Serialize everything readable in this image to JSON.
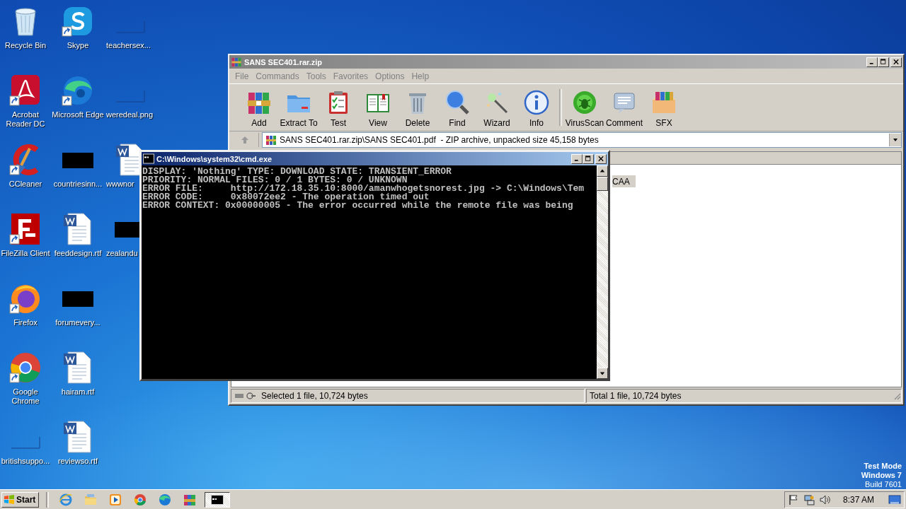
{
  "desktop_icons": [
    {
      "label": "Recycle Bin",
      "kind": "recycle",
      "shortcut": false
    },
    {
      "label": "Acrobat Reader DC",
      "kind": "acrobat",
      "shortcut": true
    },
    {
      "label": "CCleaner",
      "kind": "ccleaner",
      "shortcut": true
    },
    {
      "label": "FileZilla Client",
      "kind": "filezilla",
      "shortcut": true
    },
    {
      "label": "Firefox",
      "kind": "firefox",
      "shortcut": true
    },
    {
      "label": "Google Chrome",
      "kind": "chrome",
      "shortcut": true
    },
    {
      "label": "britishsuppo...",
      "kind": "blank",
      "shortcut": false
    },
    {
      "label": "Skype",
      "kind": "skype",
      "shortcut": true
    },
    {
      "label": "Microsoft Edge",
      "kind": "edge",
      "shortcut": true
    },
    {
      "label": "countriesinn...",
      "kind": "black",
      "shortcut": false
    },
    {
      "label": "feeddesign.rtf",
      "kind": "word",
      "shortcut": false
    },
    {
      "label": "forumevery...",
      "kind": "black",
      "shortcut": false
    },
    {
      "label": "hairam.rtf",
      "kind": "word",
      "shortcut": false
    },
    {
      "label": "reviewso.rtf",
      "kind": "word",
      "shortcut": false
    },
    {
      "label": "teachersex...",
      "kind": "blank",
      "shortcut": false
    },
    {
      "label": "weredeal.png",
      "kind": "blank",
      "shortcut": false
    },
    {
      "label": "wwwnor",
      "kind": "word",
      "shortcut": false
    },
    {
      "label": "zealandu",
      "kind": "black",
      "shortcut": false
    }
  ],
  "winrar": {
    "title": "SANS SEC401.rar.zip",
    "menu": [
      "File",
      "Commands",
      "Tools",
      "Favorites",
      "Options",
      "Help"
    ],
    "toolbar": [
      {
        "label": "Add",
        "kind": "books"
      },
      {
        "label": "Extract To",
        "kind": "folder"
      },
      {
        "label": "Test",
        "kind": "clipboard"
      },
      {
        "label": "View",
        "kind": "book"
      },
      {
        "label": "Delete",
        "kind": "trash"
      },
      {
        "label": "Find",
        "kind": "magnifier"
      },
      {
        "label": "Wizard",
        "kind": "wand"
      },
      {
        "label": "Info",
        "kind": "info"
      },
      {
        "label": "VirusScan",
        "kind": "bug"
      },
      {
        "label": "Comment",
        "kind": "note"
      },
      {
        "label": "SFX",
        "kind": "box"
      }
    ],
    "path": "SANS SEC401.rar.zip\\SANS SEC401.pdf  - ZIP archive, unpacked size 45,158 bytes",
    "rows": [
      {
        "name": "CAA",
        "selected": true
      }
    ],
    "status_left": "Selected 1 file, 10,724 bytes",
    "status_right": "Total 1 file, 10,724 bytes"
  },
  "cmd": {
    "title": "C:\\Windows\\system32\\cmd.exe",
    "lines": [
      "DISPLAY: 'Nothing' TYPE: DOWNLOAD STATE: TRANSIENT_ERROR",
      "PRIORITY: NORMAL FILES: 0 / 1 BYTES: 0 / UNKNOWN",
      "ERROR FILE:     http://172.18.35.10:8000/amanwhogetsnorest.jpg -> C:\\Windows\\Tem",
      "ERROR CODE:     0x80072ee2 - The operation timed out",
      "ERROR CONTEXT: 0x00000005 - The error occurred while the remote file was being"
    ]
  },
  "desktop_notice": [
    "Test Mode",
    "Windows 7",
    "Build 7601"
  ],
  "taskbar": {
    "start": "Start",
    "apps": [
      {
        "kind": "ie",
        "selected": false
      },
      {
        "kind": "explorer",
        "selected": false
      },
      {
        "kind": "media",
        "selected": false
      },
      {
        "kind": "chrome",
        "selected": false
      },
      {
        "kind": "edge",
        "selected": false
      },
      {
        "kind": "winrar",
        "selected": false
      },
      {
        "kind": "cmd",
        "selected": true
      }
    ],
    "clock": "8:37 AM"
  }
}
